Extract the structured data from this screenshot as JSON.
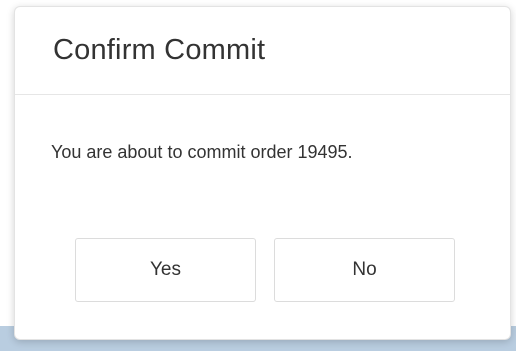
{
  "dialog": {
    "title": "Confirm Commit",
    "message": "You are about to commit order 19495.",
    "buttons": {
      "yes_label": "Yes",
      "no_label": "No"
    }
  }
}
